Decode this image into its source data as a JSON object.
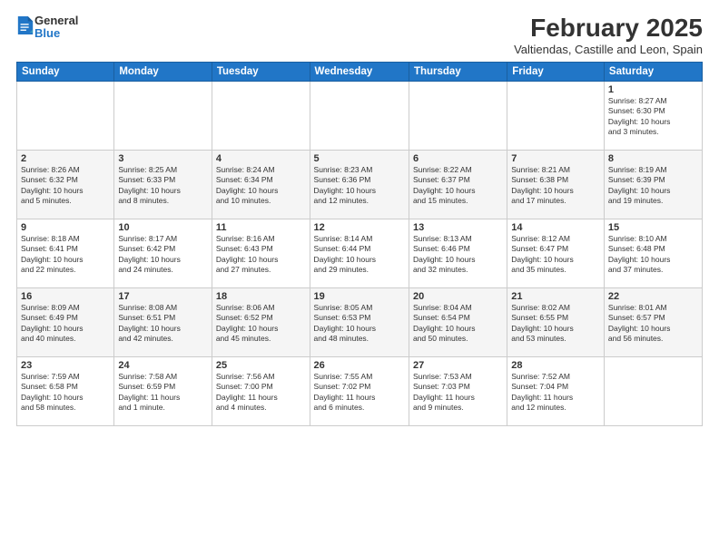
{
  "logo": {
    "general": "General",
    "blue": "Blue"
  },
  "header": {
    "month_year": "February 2025",
    "location": "Valtiendas, Castille and Leon, Spain"
  },
  "weekdays": [
    "Sunday",
    "Monday",
    "Tuesday",
    "Wednesday",
    "Thursday",
    "Friday",
    "Saturday"
  ],
  "weeks": [
    [
      {
        "day": "",
        "info": ""
      },
      {
        "day": "",
        "info": ""
      },
      {
        "day": "",
        "info": ""
      },
      {
        "day": "",
        "info": ""
      },
      {
        "day": "",
        "info": ""
      },
      {
        "day": "",
        "info": ""
      },
      {
        "day": "1",
        "info": "Sunrise: 8:27 AM\nSunset: 6:30 PM\nDaylight: 10 hours\nand 3 minutes."
      }
    ],
    [
      {
        "day": "2",
        "info": "Sunrise: 8:26 AM\nSunset: 6:32 PM\nDaylight: 10 hours\nand 5 minutes."
      },
      {
        "day": "3",
        "info": "Sunrise: 8:25 AM\nSunset: 6:33 PM\nDaylight: 10 hours\nand 8 minutes."
      },
      {
        "day": "4",
        "info": "Sunrise: 8:24 AM\nSunset: 6:34 PM\nDaylight: 10 hours\nand 10 minutes."
      },
      {
        "day": "5",
        "info": "Sunrise: 8:23 AM\nSunset: 6:36 PM\nDaylight: 10 hours\nand 12 minutes."
      },
      {
        "day": "6",
        "info": "Sunrise: 8:22 AM\nSunset: 6:37 PM\nDaylight: 10 hours\nand 15 minutes."
      },
      {
        "day": "7",
        "info": "Sunrise: 8:21 AM\nSunset: 6:38 PM\nDaylight: 10 hours\nand 17 minutes."
      },
      {
        "day": "8",
        "info": "Sunrise: 8:19 AM\nSunset: 6:39 PM\nDaylight: 10 hours\nand 19 minutes."
      }
    ],
    [
      {
        "day": "9",
        "info": "Sunrise: 8:18 AM\nSunset: 6:41 PM\nDaylight: 10 hours\nand 22 minutes."
      },
      {
        "day": "10",
        "info": "Sunrise: 8:17 AM\nSunset: 6:42 PM\nDaylight: 10 hours\nand 24 minutes."
      },
      {
        "day": "11",
        "info": "Sunrise: 8:16 AM\nSunset: 6:43 PM\nDaylight: 10 hours\nand 27 minutes."
      },
      {
        "day": "12",
        "info": "Sunrise: 8:14 AM\nSunset: 6:44 PM\nDaylight: 10 hours\nand 29 minutes."
      },
      {
        "day": "13",
        "info": "Sunrise: 8:13 AM\nSunset: 6:46 PM\nDaylight: 10 hours\nand 32 minutes."
      },
      {
        "day": "14",
        "info": "Sunrise: 8:12 AM\nSunset: 6:47 PM\nDaylight: 10 hours\nand 35 minutes."
      },
      {
        "day": "15",
        "info": "Sunrise: 8:10 AM\nSunset: 6:48 PM\nDaylight: 10 hours\nand 37 minutes."
      }
    ],
    [
      {
        "day": "16",
        "info": "Sunrise: 8:09 AM\nSunset: 6:49 PM\nDaylight: 10 hours\nand 40 minutes."
      },
      {
        "day": "17",
        "info": "Sunrise: 8:08 AM\nSunset: 6:51 PM\nDaylight: 10 hours\nand 42 minutes."
      },
      {
        "day": "18",
        "info": "Sunrise: 8:06 AM\nSunset: 6:52 PM\nDaylight: 10 hours\nand 45 minutes."
      },
      {
        "day": "19",
        "info": "Sunrise: 8:05 AM\nSunset: 6:53 PM\nDaylight: 10 hours\nand 48 minutes."
      },
      {
        "day": "20",
        "info": "Sunrise: 8:04 AM\nSunset: 6:54 PM\nDaylight: 10 hours\nand 50 minutes."
      },
      {
        "day": "21",
        "info": "Sunrise: 8:02 AM\nSunset: 6:55 PM\nDaylight: 10 hours\nand 53 minutes."
      },
      {
        "day": "22",
        "info": "Sunrise: 8:01 AM\nSunset: 6:57 PM\nDaylight: 10 hours\nand 56 minutes."
      }
    ],
    [
      {
        "day": "23",
        "info": "Sunrise: 7:59 AM\nSunset: 6:58 PM\nDaylight: 10 hours\nand 58 minutes."
      },
      {
        "day": "24",
        "info": "Sunrise: 7:58 AM\nSunset: 6:59 PM\nDaylight: 11 hours\nand 1 minute."
      },
      {
        "day": "25",
        "info": "Sunrise: 7:56 AM\nSunset: 7:00 PM\nDaylight: 11 hours\nand 4 minutes."
      },
      {
        "day": "26",
        "info": "Sunrise: 7:55 AM\nSunset: 7:02 PM\nDaylight: 11 hours\nand 6 minutes."
      },
      {
        "day": "27",
        "info": "Sunrise: 7:53 AM\nSunset: 7:03 PM\nDaylight: 11 hours\nand 9 minutes."
      },
      {
        "day": "28",
        "info": "Sunrise: 7:52 AM\nSunset: 7:04 PM\nDaylight: 11 hours\nand 12 minutes."
      },
      {
        "day": "",
        "info": ""
      }
    ]
  ]
}
